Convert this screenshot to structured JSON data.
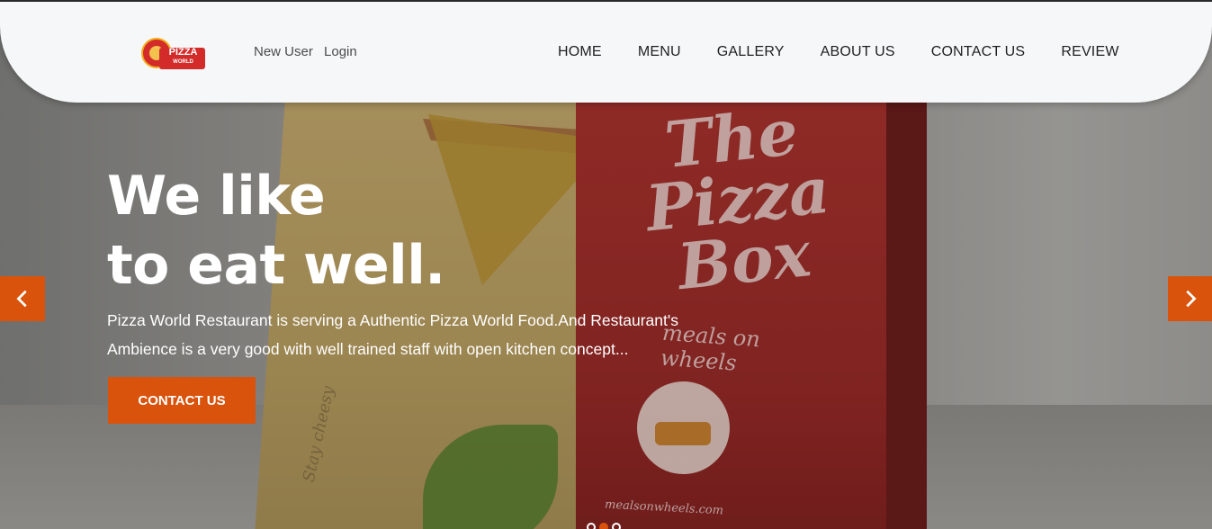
{
  "brand": {
    "logo_word": "PIZZA",
    "logo_sub": "WORLD"
  },
  "auth": {
    "new_user": "New User",
    "login": "Login"
  },
  "nav": {
    "items": [
      {
        "label": "HOME"
      },
      {
        "label": "MENU"
      },
      {
        "label": "GALLERY"
      },
      {
        "label": "ABOUT US"
      },
      {
        "label": "CONTACT US"
      },
      {
        "label": "REVIEW"
      }
    ]
  },
  "hero": {
    "headline_line1": "We like",
    "headline_line2": "to eat well.",
    "description": "Pizza World Restaurant is serving a Authentic Pizza World Food.And Restaurant's Ambience is a very good with well trained staff with open kitchen concept...",
    "cta_label": "CONTACT US",
    "image_text": {
      "box_title": "The Pizza Box",
      "box_subtitle": "meals on wheels",
      "box_url": "mealsonwheels.com",
      "box_side": "Stay cheesy"
    }
  },
  "carousel": {
    "slide_count": 3,
    "active_index": 1,
    "prev_icon": "chevron-left-icon",
    "next_icon": "chevron-right-icon"
  },
  "colors": {
    "accent": "#d9530c",
    "navbar_bg": "#f6f7f9",
    "nav_text": "#1f1f1f"
  }
}
